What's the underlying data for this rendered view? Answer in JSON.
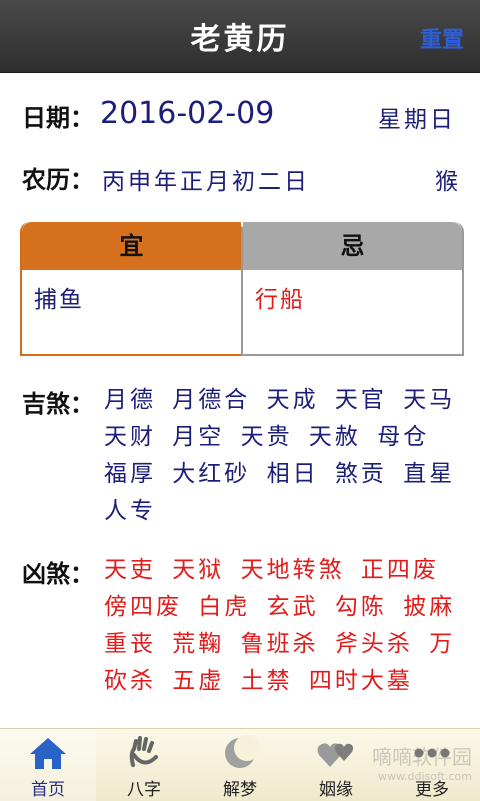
{
  "header": {
    "title": "老黄历",
    "reset_label": "重置"
  },
  "date": {
    "label": "日期：",
    "value": "2016-02-09",
    "weekday": "星期日"
  },
  "lunar": {
    "label": "农历：",
    "value": "丙申年正月初二日",
    "zodiac": "猴"
  },
  "yi": {
    "title": "宜",
    "content": "捕鱼"
  },
  "ji": {
    "title": "忌",
    "content": "行船"
  },
  "jisha": {
    "label": "吉煞：",
    "text": "月德 月德合 天成 天官 天马 天财 月空 天贵 天赦 母仓 福厚 大红砂 相日 煞贡 直星 人专"
  },
  "xiongsha": {
    "label": "凶煞：",
    "text": "天吏 天狱 天地转煞 正四废 傍四废 白虎 玄武 勾陈 披麻 重丧 荒鞠 鲁班杀 斧头杀 万砍杀 五虚 土禁 四时大墓"
  },
  "tabs": [
    {
      "label": "首页",
      "icon": "home-icon",
      "active": true
    },
    {
      "label": "八字",
      "icon": "hand-icon",
      "active": false
    },
    {
      "label": "解梦",
      "icon": "moon-icon",
      "active": false
    },
    {
      "label": "姻缘",
      "icon": "hearts-icon",
      "active": false
    },
    {
      "label": "更多",
      "icon": "more-icon",
      "active": false
    }
  ],
  "watermark": {
    "text": "嘀嘀软件园",
    "sub": "www.ddisoft.com"
  },
  "colors": {
    "header_bg": "#3a3a3a",
    "reset": "#2d5fd8",
    "navy": "#1c1f7a",
    "red": "#e21b1b",
    "yi_orange": "#d5711d",
    "ji_gray": "#a8a8a8"
  }
}
